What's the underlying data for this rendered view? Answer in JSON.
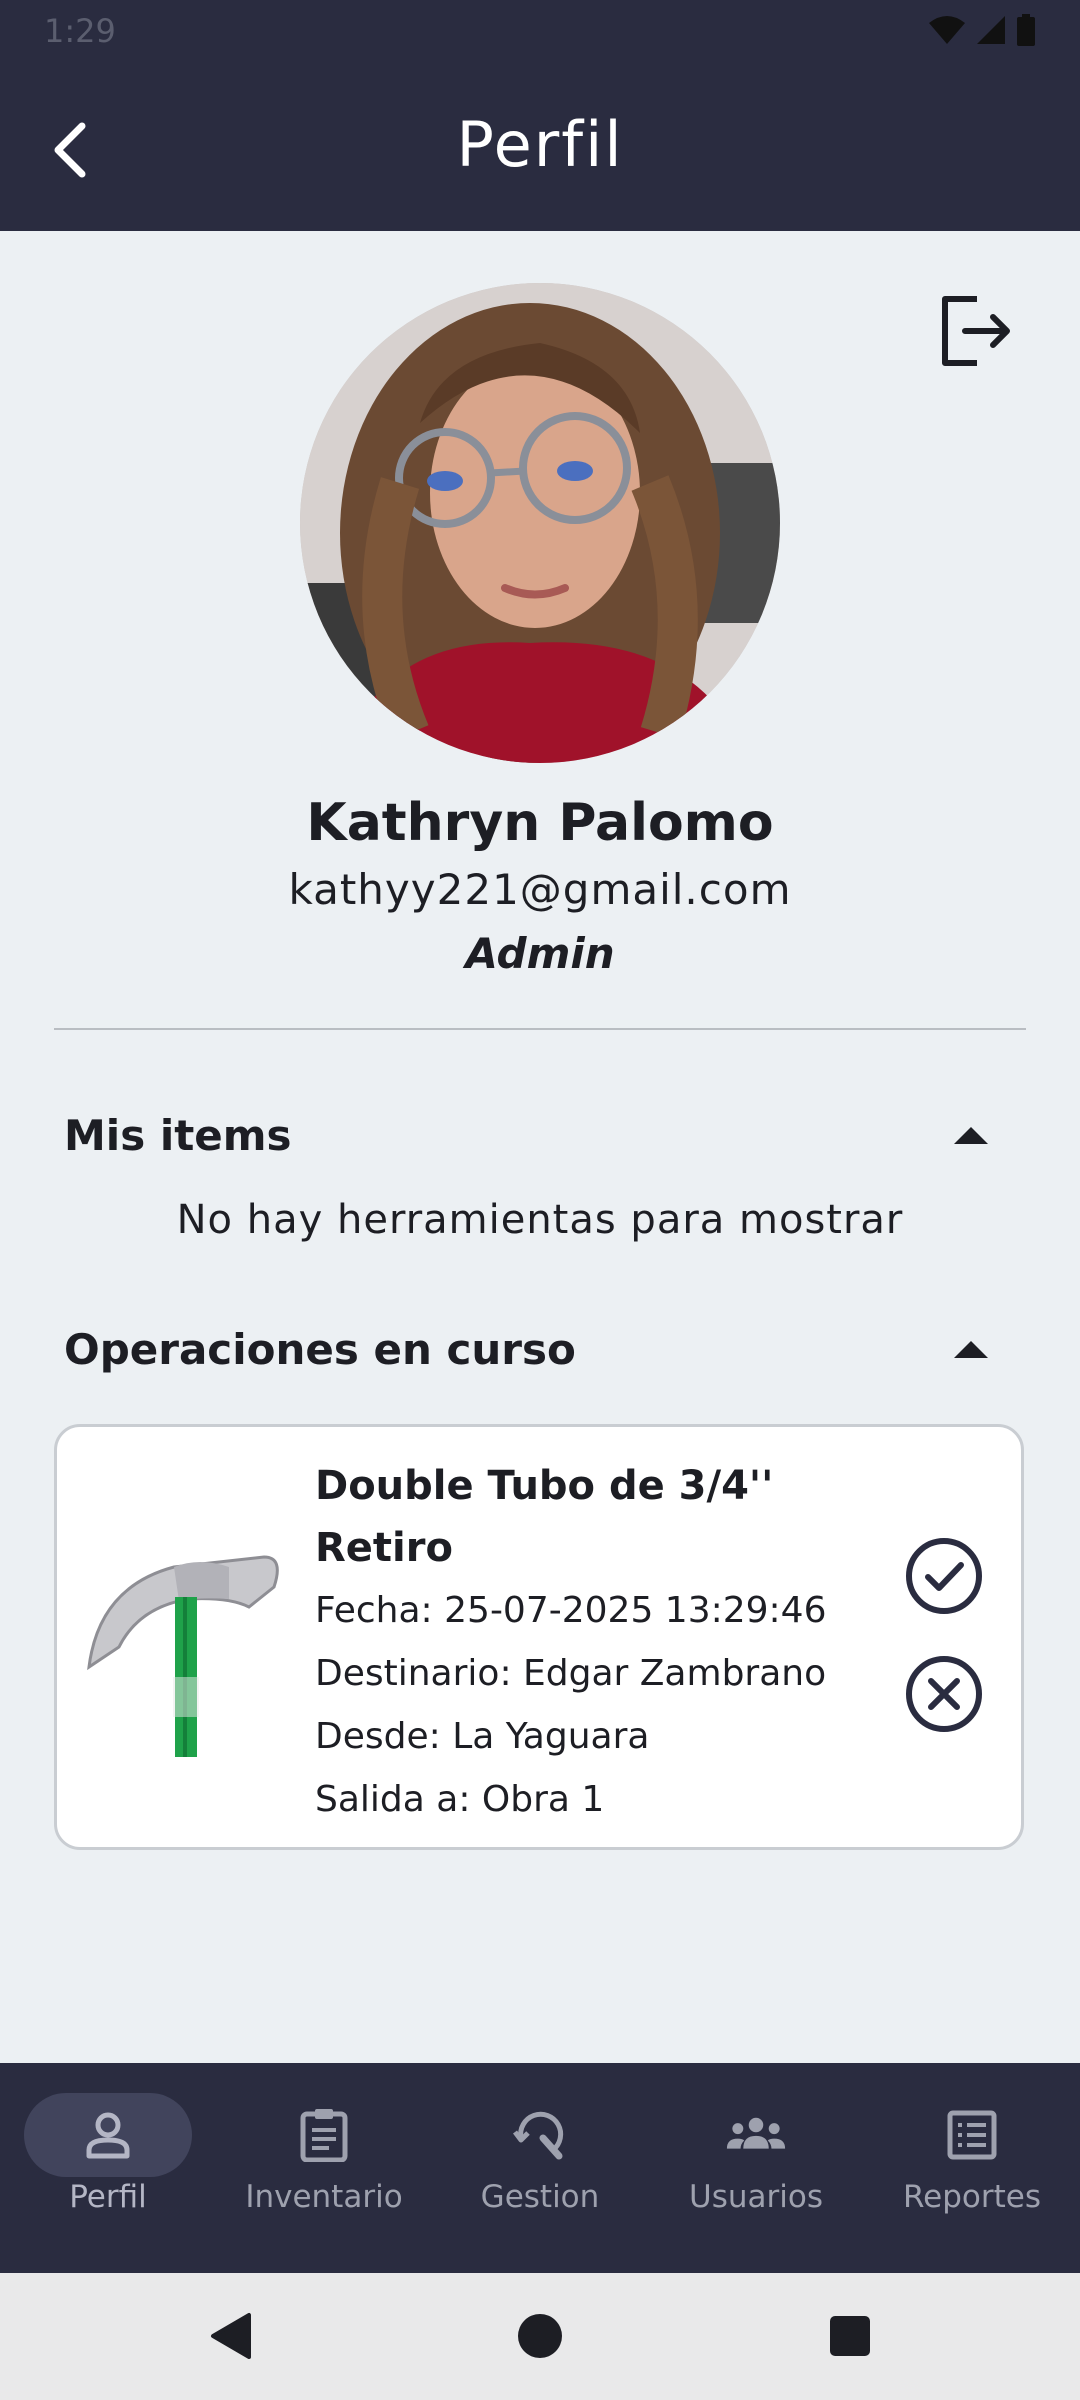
{
  "status_bar": {
    "time": "1:29"
  },
  "header": {
    "title": "Perfil"
  },
  "profile": {
    "name": "Kathryn Palomo",
    "email": "kathyy221@gmail.com",
    "role": "Admin"
  },
  "sections": {
    "mis_items": {
      "title": "Mis items",
      "empty_message": "No hay herramientas para mostrar"
    },
    "operaciones": {
      "title": "Operaciones en curso"
    }
  },
  "operation": {
    "title_line1": "Double Tubo de 3/4''",
    "title_line2": "Retiro",
    "fecha": "Fecha: 25-07-2025 13:29:46",
    "destinatario": "Destinario: Edgar Zambrano",
    "desde": "Desde: La Yaguara",
    "salida": "Salida a: Obra 1"
  },
  "bottom_nav": {
    "items": [
      {
        "label": "Perfil",
        "icon": "person-icon",
        "active": true
      },
      {
        "label": "Inventario",
        "icon": "clipboard-icon",
        "active": false
      },
      {
        "label": "Gestion",
        "icon": "sync-tool-icon",
        "active": false
      },
      {
        "label": "Usuarios",
        "icon": "group-icon",
        "active": false
      },
      {
        "label": "Reportes",
        "icon": "list-document-icon",
        "active": false
      }
    ]
  },
  "colors": {
    "app_bar": "#2a2c40",
    "background": "#ecf0f3",
    "card": "#ffffff",
    "text": "#1d1e24",
    "nav_label": "#9ea1ae"
  }
}
